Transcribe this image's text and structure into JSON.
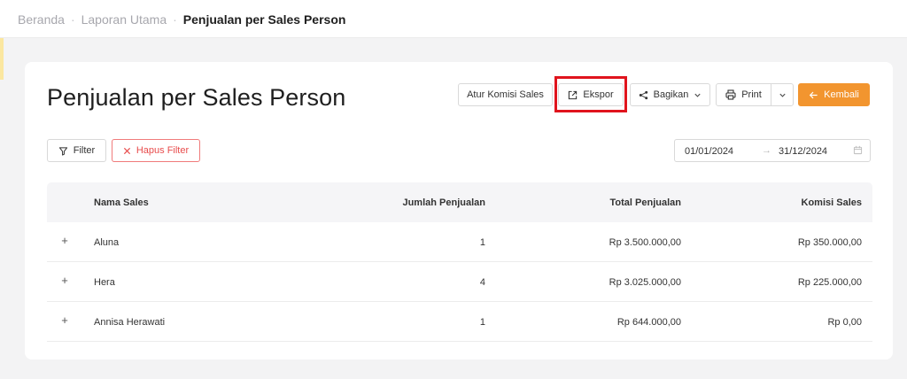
{
  "breadcrumb": {
    "items": [
      "Beranda",
      "Laporan Utama"
    ],
    "separator": "·",
    "current": "Penjualan per Sales Person"
  },
  "page": {
    "title": "Penjualan per Sales Person"
  },
  "toolbar": {
    "komisi_label": "Atur Komisi Sales",
    "ekspor_label": "Ekspor",
    "bagikan_label": "Bagikan",
    "print_label": "Print",
    "kembali_label": "Kembali"
  },
  "filters": {
    "filter_label": "Filter",
    "hapus_label": "Hapus Filter",
    "date_start": "01/01/2024",
    "date_arrow": "→",
    "date_end": "31/12/2024"
  },
  "table": {
    "headers": {
      "name": "Nama Sales",
      "jumlah": "Jumlah Penjualan",
      "total": "Total Penjualan",
      "komisi": "Komisi Sales"
    },
    "rows": [
      {
        "name": "Aluna",
        "jumlah": "1",
        "total": "Rp 3.500.000,00",
        "komisi": "Rp 350.000,00"
      },
      {
        "name": "Hera",
        "jumlah": "4",
        "total": "Rp 3.025.000,00",
        "komisi": "Rp 225.000,00"
      },
      {
        "name": "Annisa Herawati",
        "jumlah": "1",
        "total": "Rp 644.000,00",
        "komisi": "Rp 0,00"
      }
    ],
    "expand_symbol": "+"
  },
  "colors": {
    "accent": "#f2952f",
    "danger": "#e84c4c",
    "highlight": "#e0141d"
  }
}
